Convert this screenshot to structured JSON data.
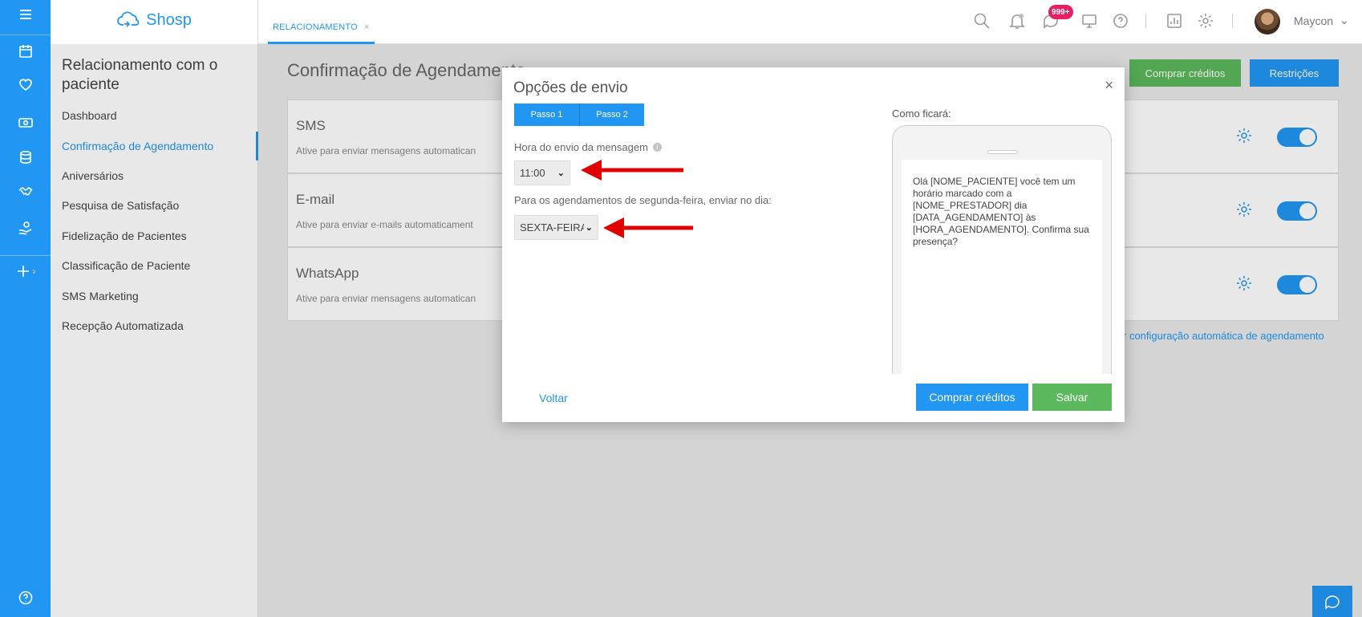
{
  "app": {
    "logo_text": "Shosp"
  },
  "rail": {
    "items": [
      "menu-icon",
      "calendar-icon",
      "heart-icon",
      "cash-icon",
      "database-icon",
      "handshake-icon",
      "hand-money-icon",
      "plus-icon"
    ],
    "help_icon": "help-icon"
  },
  "sidebar": {
    "title": "Relacionamento com o paciente",
    "items": [
      {
        "label": "Dashboard"
      },
      {
        "label": "Confirmação de Agendamento"
      },
      {
        "label": "Aniversários"
      },
      {
        "label": "Pesquisa de Satisfação"
      },
      {
        "label": "Fidelização de Pacientes"
      },
      {
        "label": "Classificação de Paciente"
      },
      {
        "label": "SMS Marketing"
      },
      {
        "label": "Recepção Automatizada"
      }
    ],
    "active_index": 1
  },
  "topbar": {
    "tab_label": "RELACIONAMENTO",
    "tab_close": "×",
    "badge": "999+",
    "user_name": "Maycon",
    "user_chevron": "⌄"
  },
  "page": {
    "title": "Confirmação de Agendamento",
    "buy_credits": "Comprar créditos",
    "restrictions": "Restrições",
    "auto_link": "r configuração automática de agendamento"
  },
  "channels": [
    {
      "name": "SMS",
      "desc": "Ative para enviar mensagens automatican",
      "enabled": true
    },
    {
      "name": "E-mail",
      "desc": "Ative para enviar e-mails automaticament",
      "enabled": true
    },
    {
      "name": "WhatsApp",
      "desc": "Ative para enviar mensagens automatican",
      "enabled": true
    }
  ],
  "modal": {
    "title": "Opções de envio",
    "close": "×",
    "steps": [
      "Passo 1",
      "Passo 2"
    ],
    "time_label": "Hora do envio da mensagem",
    "time_value": "11:00",
    "day_label": "Para os agendamentos de segunda-feira, enviar no dia:",
    "day_value": "SEXTA-FEIRA",
    "preview_label": "Como ficará:",
    "preview_text": "Olá [NOME_PACIENTE] você tem um horário marcado com a [NOME_PRESTADOR] dia [DATA_AGENDAMENTO] às [HORA_AGENDAMENTO]. Confirma sua presença?",
    "back": "Voltar",
    "buy_credits": "Comprar créditos",
    "save": "Salvar"
  },
  "colors": {
    "primary": "#2196f3",
    "success": "#5cb85c",
    "badge": "#e91e63",
    "arrow": "#e00000"
  }
}
